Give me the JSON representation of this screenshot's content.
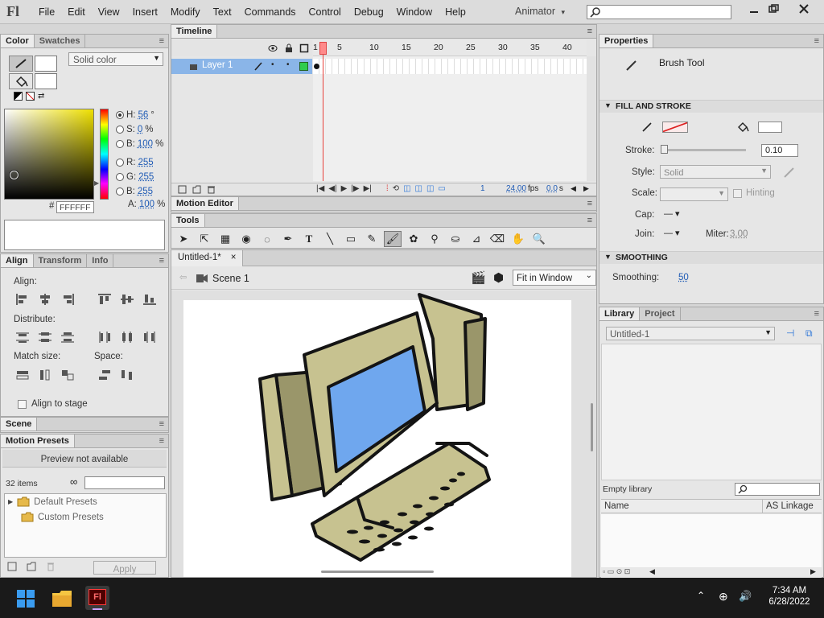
{
  "menubar": {
    "logo": "Fl",
    "items": [
      "File",
      "Edit",
      "View",
      "Insert",
      "Modify",
      "Text",
      "Commands",
      "Control",
      "Debug",
      "Window",
      "Help"
    ],
    "workspace": "Animator",
    "workspace_arrow": "▾"
  },
  "color_panel": {
    "tabs": [
      "Color",
      "Swatches"
    ],
    "fill_type": "Solid color",
    "hsb": [
      {
        "label": "H:",
        "value": "56",
        "unit": "°"
      },
      {
        "label": "S:",
        "value": "0",
        "unit": "%"
      },
      {
        "label": "B:",
        "value": "100",
        "unit": "%"
      }
    ],
    "rgb": [
      {
        "label": "R:",
        "value": "255"
      },
      {
        "label": "G:",
        "value": "255"
      },
      {
        "label": "B:",
        "value": "255"
      }
    ],
    "alpha_label": "A:",
    "alpha": "100",
    "alpha_unit": "%",
    "hex_prefix": "#",
    "hex": "FFFFFF"
  },
  "align_panel": {
    "tabs": [
      "Align",
      "Transform",
      "Info"
    ],
    "align": "Align:",
    "distribute": "Distribute:",
    "match_size": "Match size:",
    "space": "Space:",
    "align_to_stage": "Align to stage"
  },
  "scene_panel": {
    "title": "Scene"
  },
  "presets": {
    "title": "Motion Presets",
    "preview": "Preview not available",
    "count": "32 items",
    "folders": [
      "Default Presets",
      "Custom Presets"
    ],
    "apply": "Apply"
  },
  "timeline": {
    "title": "Timeline",
    "layer": "Layer 1",
    "frame_numbers": [
      "1",
      "5",
      "10",
      "15",
      "20",
      "25",
      "30",
      "35",
      "40"
    ],
    "frame": "1",
    "fps": "24.00",
    "fps_unit": "fps",
    "time": "0.0",
    "time_unit": "s"
  },
  "motion_editor": {
    "title": "Motion Editor"
  },
  "tools": {
    "title": "Tools"
  },
  "document": {
    "tab": "Untitled-1*",
    "close": "×",
    "scene": "Scene 1",
    "zoom": "Fit in Window"
  },
  "properties": {
    "title": "Properties",
    "tool": "Brush Tool",
    "section_fill": "FILL AND STROKE",
    "stroke_label": "Stroke:",
    "stroke_value": "0.10",
    "style_label": "Style:",
    "style_value": "Solid",
    "scale_label": "Scale:",
    "hinting": "Hinting",
    "cap_label": "Cap:",
    "join_label": "Join:",
    "miter_label": "Miter:",
    "miter_value": "3.00",
    "section_smooth": "SMOOTHING",
    "smoothing_label": "Smoothing:",
    "smoothing_value": "50"
  },
  "library": {
    "tabs": [
      "Library",
      "Project"
    ],
    "doc": "Untitled-1",
    "empty": "Empty library",
    "col_name": "Name",
    "col_linkage": "AS Linkage"
  },
  "taskbar": {
    "time": "7:34 AM",
    "date": "6/28/2022",
    "app_label": "Fl"
  },
  "colors": {
    "accent": "#2f77d8",
    "playhead": "#e8413b",
    "art_fill": "#c7c290",
    "screen": "#6fa7ee",
    "layer_green": "#2fcc4d"
  }
}
